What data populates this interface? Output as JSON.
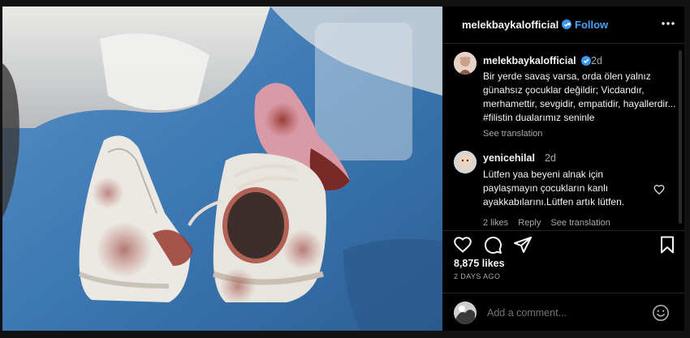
{
  "header": {
    "username": "melekbaykalofficial",
    "separator": "•",
    "follow_label": "Follow"
  },
  "caption": {
    "username": "melekbaykalofficial",
    "time": "2d",
    "text": "Bir yerde savaş varsa, orda ölen yalnız günahsız çocuklar değildir; Vicdandır, merhamettir, sevgidir, empatidir, hayallerdir... #filistin dualarımız seninle",
    "see_translation": "See translation"
  },
  "comment": {
    "username": "yenicehilal",
    "time": "2d",
    "text": "Lütfen yaa beyeni alnak için paylaşmayın çocukların kanlı ayakkabılarını.Lütfen artık lütfen.",
    "likes": "2 likes",
    "reply": "Reply",
    "see_translation": "See translation"
  },
  "post": {
    "likes": "8,875 likes",
    "ago": "2 DAYS AGO"
  },
  "add_comment": {
    "placeholder": "Add a comment..."
  },
  "colors": {
    "accent": "#4aa3f5",
    "verified": "#3897f0",
    "muted": "#a8a8a8"
  },
  "icons": [
    "more-icon",
    "heart-icon",
    "comment-icon",
    "share-icon",
    "bookmark-icon",
    "emoji-icon",
    "verified-icon"
  ]
}
